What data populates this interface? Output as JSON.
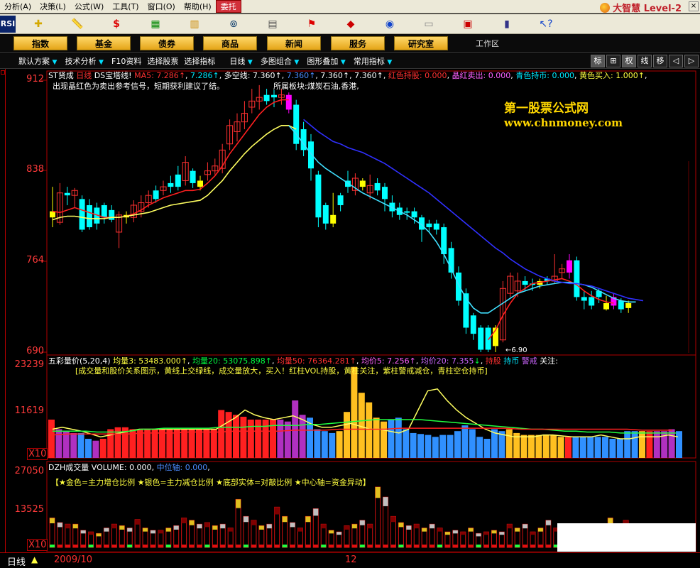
{
  "menu": {
    "items": [
      "分析(A)",
      "决策(L)",
      "公式(W)",
      "工具(T)",
      "窗口(O)",
      "帮助(H)",
      "委托"
    ],
    "brand": "大智慧 Level-2"
  },
  "toolbar": {
    "rsi_label": "RSI"
  },
  "nav": {
    "buttons": [
      "指数",
      "基金",
      "债券",
      "商品",
      "新闻",
      "服务",
      "研究室"
    ],
    "workarea": "工作区"
  },
  "options": {
    "items": [
      "默认方案",
      "技术分析",
      "F10资料",
      "选择股票",
      "选择指标",
      "日线",
      "多图组合",
      "图形叠加",
      "常用指标"
    ],
    "right_buttons": [
      "标",
      "⊞",
      "权",
      "线",
      "移",
      "◁",
      "▷"
    ]
  },
  "main_panel": {
    "axis_labels": [
      "912",
      "838",
      "764",
      "690"
    ],
    "title_name": "ST贤成",
    "title_period": "日线",
    "indicator": "DS宝塔线!",
    "ma5_label": "MA5:",
    "ma5_value": "7.286",
    "ma5_value2": "7.286",
    "duokong_label": "多空线:",
    "duokong_value": "7.360",
    "duokong_value2": "7.360",
    "duokong_value3": "7.360",
    "duokong_value4": "7.360",
    "hongse_label": "红色持股:",
    "hongse_value": "0.000",
    "jinghong_label": "晶红卖出:",
    "jinghong_value": "0.000",
    "qingse_label": "青色持币:",
    "qingse_value": "0.000",
    "huangse_label": "黄色买入:",
    "huangse_value": "1.000",
    "line2": "出现晶红色为卖出参考信号，短期获利建议了结。",
    "sector": "所属板块:煤炭石油,香港,",
    "low_marker": "←6.90",
    "watermark_line1": "第一股票公式网",
    "watermark_line2": "www.chnmoney.com"
  },
  "vol_panel": {
    "axis_labels": [
      "23239",
      "11619"
    ],
    "x10": "X10",
    "title": "五彩量价(5,20,4)",
    "jl3_label": "均量3:",
    "jl3_value": "53483.000",
    "jl20_label": "均量20:",
    "jl20_value": "53075.898",
    "jl50_label": "均量50:",
    "jl50_value": "76364.281",
    "jj5_label": "均价5:",
    "jj5_value": "7.256",
    "jj20_label": "均价20:",
    "jj20_value": "7.355",
    "legend": [
      "持股",
      "持币",
      "警戒",
      "关注:"
    ],
    "line2": "[成交量和股价关系图示，黄线上交绿线，成交量放大，买入！红柱VOL持股，黄柱关注，紫柱警戒减仓，青柱空仓持币]"
  },
  "dzh_panel": {
    "axis_labels": [
      "27050",
      "13525"
    ],
    "x10": "X10",
    "title": "DZH成交量",
    "vol_label": "VOLUME:",
    "vol_value": "0.000",
    "axis_label": "中位轴:",
    "axis_value": "0.000",
    "line2": "【★金色=主力增仓比例 ★银色=主力减仓比例 ★底部实体=对敲比例 ★中心轴=资金异动】"
  },
  "status": {
    "period": "日线",
    "date1": "2009/10",
    "date2": "12"
  },
  "colors": {
    "up": "#ff3030",
    "down": "#00ffff",
    "yellow": "#ffff00",
    "magenta": "#ff00ff",
    "ma_red": "#ff2020",
    "ma_yellow": "#ffff60",
    "ma_cyan": "#40e0ff",
    "ma_blue": "#3030ff"
  }
}
